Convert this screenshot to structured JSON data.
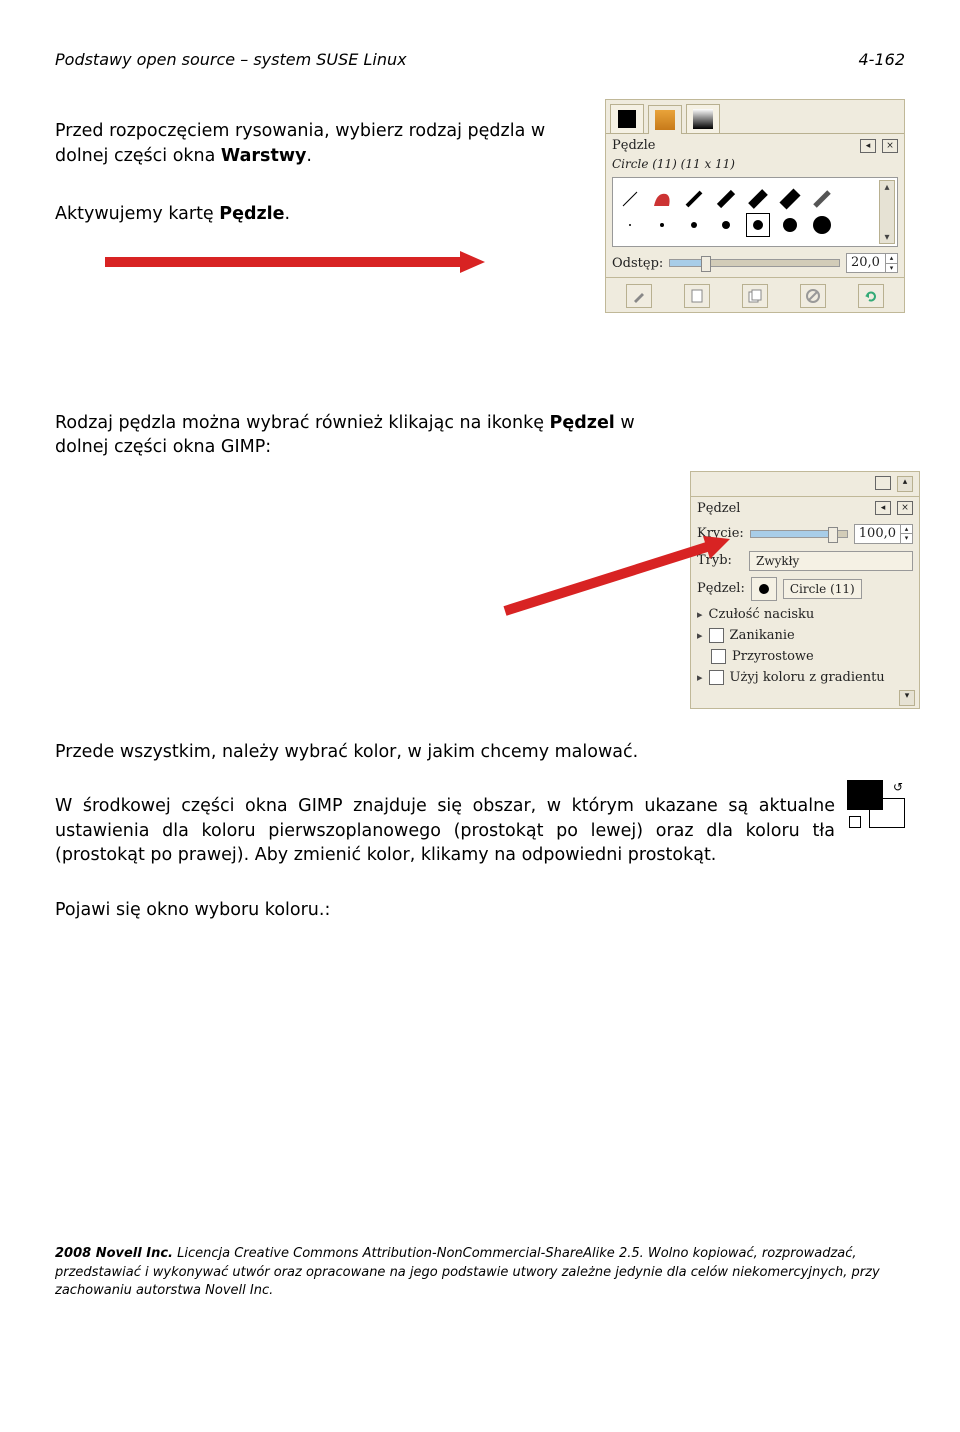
{
  "header": {
    "title": "Podstawy open  source – system SUSE Linux",
    "page_num": "4-162"
  },
  "para1": {
    "pre": "Przed rozpoczęciem rysowania, wybierz rodzaj pędzla w dolnej części okna ",
    "bold": "Warstwy",
    "post": "."
  },
  "para2": {
    "pre": "Aktywujemy kartę ",
    "bold": "Pędzle",
    "post": "."
  },
  "panel1": {
    "label": "Pędzle",
    "subtitle": "Circle (11) (11 x 11)",
    "spacing_label": "Odstęp:",
    "spacing_value": "20,0"
  },
  "para3": {
    "pre": "Rodzaj pędzla można wybrać również klikając na ikonkę ",
    "bold": "Pędzel",
    "post": " w dolnej części okna GIMP:"
  },
  "panel2": {
    "label": "Pędzel",
    "opacity_label": "Krycie:",
    "opacity_value": "100,0",
    "mode_label": "Tryb:",
    "mode_value": "Zwykły",
    "brush_label": "Pędzel:",
    "brush_name": "Circle (11)",
    "pressure_label": "Czułość nacisku",
    "fade_label": "Zanikanie",
    "incremental_label": "Przyrostowe",
    "gradient_label": "Użyj koloru z gradientu"
  },
  "para4": "Przede wszystkim, należy wybrać kolor, w jakim chcemy malować.",
  "para5": "W środkowej części okna GIMP znajduje się obszar, w którym ukazane są aktualne ustawienia dla koloru pierwszoplanowego (prostokąt po lewej) oraz dla koloru tła (prostokąt po prawej). Aby zmienić kolor, klikamy na odpowiedni prostokąt.",
  "para6": " Pojawi się okno wyboru koloru.:",
  "footer": {
    "line1_bold": "2008 Novell Inc.",
    "line1_rest": " Licencja Creative Commons Attribution-NonCommercial-ShareAlike 2.5. Wolno kopiować, rozprowadzać, przedstawiać i wykonywać utwór oraz opracowane na jego podstawie utwory zależne jedynie dla celów niekomercyjnych, przy zachowaniu autorstwa Novell Inc."
  },
  "icons": {
    "edit": "edit-icon",
    "new": "new-icon",
    "duplicate": "duplicate-icon",
    "delete": "delete-icon",
    "refresh": "refresh-icon",
    "triangle_left": "triangle-left-icon",
    "close": "close-icon",
    "expander": "expander-icon",
    "scroll_up": "scroll-up-icon",
    "scroll_down": "scroll-down-icon",
    "swap": "swap-icon"
  }
}
